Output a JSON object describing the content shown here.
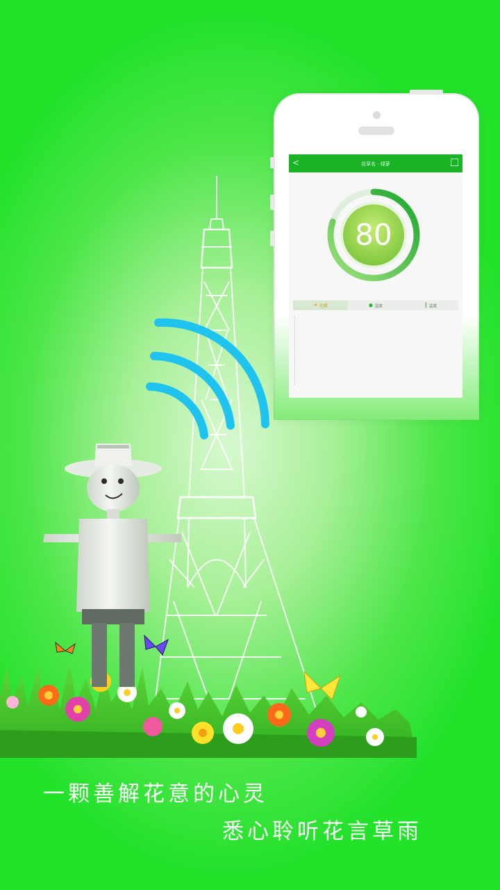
{
  "phone_screen": {
    "app_title": "花草名 · 绿萝",
    "back_glyph": "<",
    "gauge": {
      "value": "80",
      "fraction": 0.8
    },
    "tabs": [
      {
        "label": "光照",
        "icon": "sun-icon"
      },
      {
        "label": "湿度",
        "icon": "drop-icon"
      },
      {
        "label": "温度",
        "icon": "thermometer-icon"
      }
    ]
  },
  "slogan": {
    "line1": "一颗善解花意的心灵",
    "line2": "悉心聆听花言草雨"
  },
  "colors": {
    "background": "#22e22a",
    "accent_green": "#18b424",
    "signal_blue": "#1ec3f0"
  }
}
